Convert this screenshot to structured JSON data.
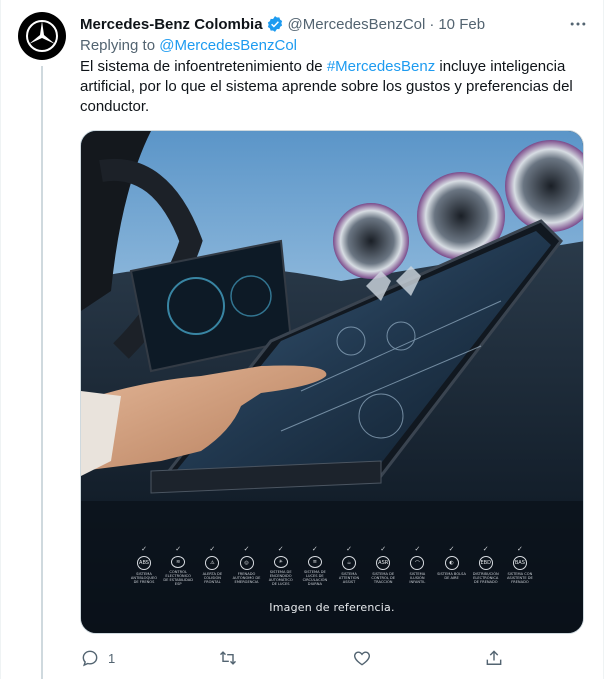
{
  "tweet": {
    "author_name": "Mercedes-Benz Colombia",
    "handle": "@MercedesBenzCol",
    "separator": "·",
    "date": "10 Feb",
    "replying_prefix": "Replying to",
    "replying_to": "@MercedesBenzCol",
    "text_before": "El sistema de infoentretenimiento de ",
    "hashtag": "#MercedesBenz",
    "text_after": " incluye inteligencia artificial, por lo que el sistema aprende sobre los gustos y preferencias del conductor.",
    "verified": true
  },
  "media": {
    "caption": "Imagen de referencia.",
    "features": [
      {
        "icon": "ABS",
        "label": "SISTEMA ANTIBLOQUEO DE FRENOS"
      },
      {
        "icon": "≋",
        "label": "CONTROL ELECTRÓNICO DE ESTABILIDAD ESP"
      },
      {
        "icon": "⚠",
        "label": "ALERTA DE COLISIÓN FRONTAL"
      },
      {
        "icon": "◎",
        "label": "FRENADO AUTÓNOMO DE EMERGENCIA"
      },
      {
        "icon": "☀",
        "label": "SISTEMA DE ENCENDIDO AUTOMÁTICO DE LUCES"
      },
      {
        "icon": "≡",
        "label": "SISTEMA DE LUCES DE CIRCULACIÓN DIURNA"
      },
      {
        "icon": "☕",
        "label": "SISTEMA ATTENTION ASSIST"
      },
      {
        "icon": "ASR",
        "label": "SISTEMA DE CONTROL DE TRACCIÓN"
      },
      {
        "icon": "⌒",
        "label": "SISTEMA ILUSIÓN INFANTIL"
      },
      {
        "icon": "◐",
        "label": "SISTEMA BOLSA DE AIRE"
      },
      {
        "icon": "EBD",
        "label": "DISTRIBUCIÓN ELECTRÓNICA DE FRENADO"
      },
      {
        "icon": "BAS",
        "label": "SISTEMA CON ASISTENTE DE FRENADO"
      }
    ]
  },
  "actions": {
    "reply_count": "1",
    "retweet_count": "",
    "like_count": ""
  },
  "colors": {
    "accent": "#1d9bf0",
    "secondary_text": "#536471",
    "primary_text": "#0f1419"
  }
}
